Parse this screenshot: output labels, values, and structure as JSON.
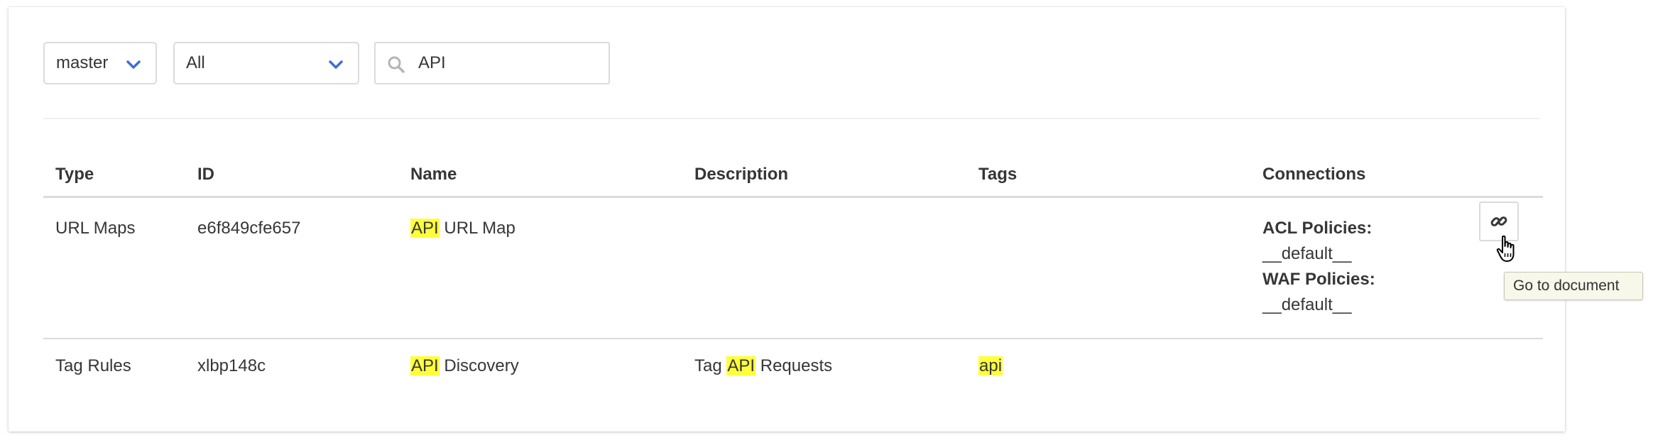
{
  "filters": {
    "branch": {
      "selected": "master"
    },
    "type": {
      "selected": "All"
    },
    "search": {
      "value": "API",
      "placeholder": ""
    }
  },
  "table": {
    "headers": [
      "Type",
      "ID",
      "Name",
      "Description",
      "Tags",
      "Connections"
    ],
    "rows": [
      {
        "type": "URL Maps",
        "id": "e6f849cfe657",
        "name_highlight": "API",
        "name_rest": " URL Map",
        "description_pre": "",
        "description_highlight": "",
        "description_post": "",
        "tags": "",
        "connections": [
          {
            "label": "ACL Policies:",
            "value": "__default__"
          },
          {
            "label": "WAF Policies:",
            "value": "__default__"
          }
        ]
      },
      {
        "type": "Tag Rules",
        "id": "xlbp148c",
        "name_highlight": "API",
        "name_rest": " Discovery",
        "description_pre": "Tag ",
        "description_highlight": "API",
        "description_post": " Requests",
        "tags": "api",
        "connections": []
      }
    ]
  },
  "tooltip": {
    "text": "Go to document"
  },
  "icons": {
    "chevron": "chevron-down-icon",
    "search": "search-icon",
    "link": "link-icon",
    "cursor": "hand-pointer-icon"
  },
  "colors": {
    "highlight": "#ffff3b",
    "chevron": "#3e6fd8",
    "border": "#dbdbdb"
  }
}
